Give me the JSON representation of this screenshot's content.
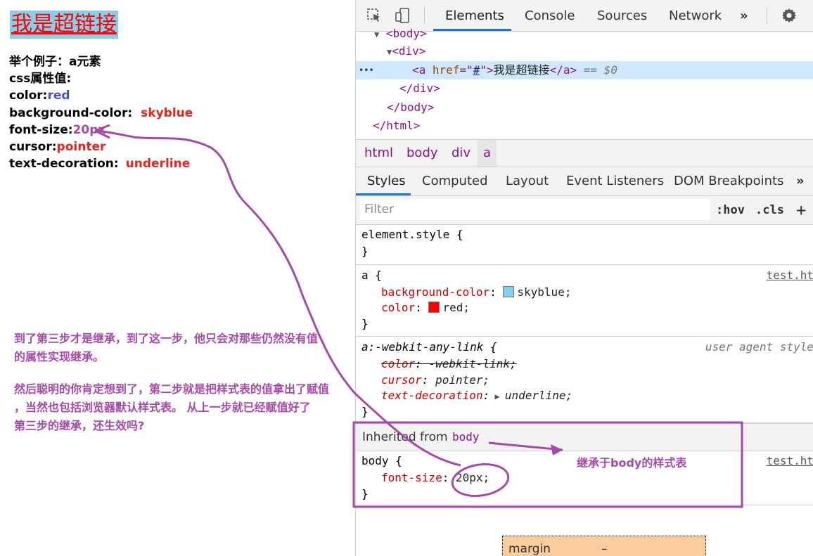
{
  "page": {
    "link_text": "我是超链接",
    "lines": [
      {
        "label": "举个例子：",
        "value": "a元素"
      },
      {
        "label": "css属性值:",
        "value": ""
      },
      {
        "label": "color:",
        "value": "red"
      },
      {
        "label": "background-color:",
        "value": "skyblue"
      },
      {
        "label": "font-size:",
        "value": "20px"
      },
      {
        "label": "cursor:",
        "value": "pointer"
      },
      {
        "label": "text-decoration:",
        "value": "underline"
      }
    ],
    "annotation_lines": [
      "到了第三步才是继承，到了这一步，他只会对那些仍然没有值",
      "的属性实现继承。",
      "然后聪明的你肯定想到了，第二步就是把样式表的值拿出了赋值",
      "，当然也包括浏览器默认样式表。 从上一步就已经赋值好了",
      "第三步的继承，还生效吗?"
    ],
    "inherit_note": "继承于body的样式表"
  },
  "devtools": {
    "tabs": [
      "Elements",
      "Console",
      "Sources",
      "Network"
    ],
    "more": "»",
    "dom": {
      "body_open": "<body>",
      "div_open": "<div>",
      "a_open_tag": "<a",
      "a_attr_name": "href",
      "a_attr_eq": "=\"",
      "a_attr_value": "#",
      "a_attr_close": "\">",
      "a_text": "我是超链接",
      "a_close": "</a>",
      "a_suffix": "== $0",
      "dots": "•••",
      "div_close": "</div>",
      "body_close": "</body>",
      "html_close": "</html>"
    },
    "breadcrumbs": [
      "html",
      "body",
      "div",
      "a"
    ],
    "subtabs": [
      "Styles",
      "Computed",
      "Layout",
      "Event Listeners",
      "DOM Breakpoints"
    ],
    "filter_placeholder": "Filter",
    "hov": ":hov",
    "cls": ".cls",
    "plus": "+",
    "element_style": {
      "selector": "element.style {",
      "close": "}"
    },
    "rule_a": {
      "selector": "a {",
      "source": "test.ht",
      "props": [
        {
          "name": "background-color",
          "value": "skyblue;",
          "swatch": "#87ceeb"
        },
        {
          "name": "color",
          "value": "red;",
          "swatch": "#ff0000"
        }
      ],
      "close": "}"
    },
    "rule_ua": {
      "selector": "a:-webkit-any-link {",
      "source": "user agent style",
      "props": [
        {
          "name": "color",
          "value": "-webkit-link;",
          "struck": true
        },
        {
          "name": "cursor",
          "value": "pointer;"
        },
        {
          "name": "text-decoration",
          "value": "underline;"
        }
      ],
      "close": "}"
    },
    "inherited": {
      "label": "Inherited from",
      "from": "body"
    },
    "rule_body": {
      "selector": "body {",
      "source": "test.ht",
      "prop": "font-size",
      "value": "20px;",
      "close": "}"
    },
    "box_model": {
      "label": "margin",
      "value": "–"
    }
  },
  "colors": {
    "annotation": "#a54aa8",
    "accent": "#1a73e8"
  }
}
